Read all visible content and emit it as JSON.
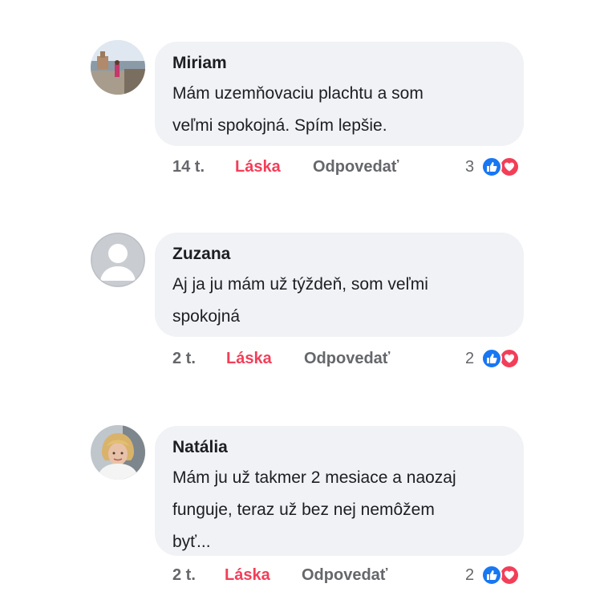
{
  "colors": {
    "bubble": "#f0f2f5",
    "love": "#f33e58",
    "like": "#1877f2",
    "meta": "#65676b"
  },
  "comments": [
    {
      "author": "Miriam",
      "lines": [
        "Mám uzemňovaciu plachtu a som",
        "veľmi spokojná. Spím lepšie."
      ],
      "time": "14 t.",
      "love_label": "Láska",
      "reply_label": "Odpovedať",
      "reaction_count": "3",
      "avatar": "photo-avatar"
    },
    {
      "author": "Zuzana",
      "lines": [
        "Aj ja ju mám už týždeň, som veľmi",
        "spokojná"
      ],
      "time": "2 t.",
      "love_label": "Láska",
      "reply_label": "Odpovedať",
      "reaction_count": "2",
      "avatar": "default-avatar"
    },
    {
      "author": "Natália",
      "lines": [
        "Mám ju už takmer 2 mesiace a naozaj",
        "funguje, teraz už bez nej nemôžem",
        "byť..."
      ],
      "time": "2 t.",
      "love_label": "Láska",
      "reply_label": "Odpovedať",
      "reaction_count": "2",
      "avatar": "photo-avatar"
    }
  ]
}
